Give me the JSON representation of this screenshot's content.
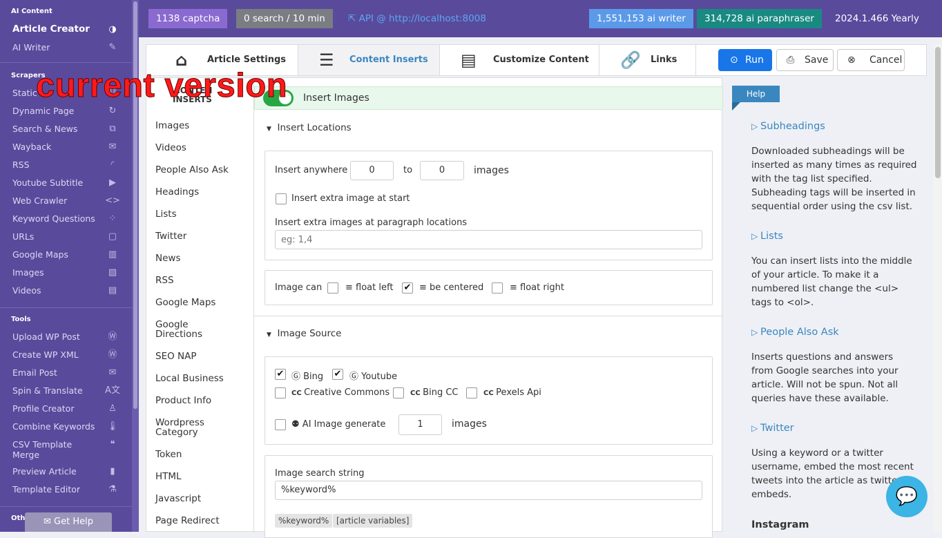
{
  "sidebar": {
    "ai_content_heading": "AI Content",
    "ai_items": [
      {
        "label": "Article Creator",
        "icon": "openai-icon"
      },
      {
        "label": "AI Writer",
        "icon": "edit-icon"
      }
    ],
    "scrapers_heading": "Scrapers",
    "scraper_items": [
      {
        "label": "Static",
        "icon": "link-icon"
      },
      {
        "label": "Dynamic Page",
        "icon": "refresh-icon"
      },
      {
        "label": "Search & News",
        "icon": "copy-icon"
      },
      {
        "label": "Wayback",
        "icon": "mail-icon"
      },
      {
        "label": "RSS",
        "icon": "rss-icon"
      },
      {
        "label": "Youtube Subtitle",
        "icon": "youtube-icon"
      },
      {
        "label": "Web Crawler",
        "icon": "code-icon"
      },
      {
        "label": "Keyword Questions",
        "icon": "grid-icon"
      },
      {
        "label": "URLs",
        "icon": "window-icon"
      },
      {
        "label": "Google Maps",
        "icon": "map-icon"
      },
      {
        "label": "Images",
        "icon": "image-icon"
      },
      {
        "label": "Videos",
        "icon": "film-icon"
      }
    ],
    "tools_heading": "Tools",
    "tool_items": [
      {
        "label": "Upload WP Post",
        "icon": "wordpress-icon"
      },
      {
        "label": "Create WP XML",
        "icon": "wordpress-icon"
      },
      {
        "label": "Email Post",
        "icon": "mail-icon"
      },
      {
        "label": "Spin & Translate",
        "icon": "translate-icon"
      },
      {
        "label": "Profile Creator",
        "icon": "user-icon"
      },
      {
        "label": "Combine Keywords",
        "icon": "thermometer-icon"
      },
      {
        "label": "CSV Template Merge",
        "icon": "quote-icon"
      },
      {
        "label": "Preview Article",
        "icon": "file-icon"
      },
      {
        "label": "Template Editor",
        "icon": "flask-icon"
      }
    ],
    "other_heading": "Othe",
    "get_help": "Get Help"
  },
  "topbar": {
    "captcha": "1138 captcha",
    "search": "0 search / 10 min",
    "api": "API @ http://localhost:8008",
    "ai_writer": "1,551,153 ai writer",
    "paraphraser": "314,728 ai paraphraser",
    "version": "2024.1.466 Yearly"
  },
  "tabs": {
    "article_settings": "Article Settings",
    "content_inserts": "Content Inserts",
    "customize_content": "Customize Content",
    "links": "Links"
  },
  "buttons": {
    "run": "Run",
    "save": "Save",
    "cancel": "Cancel"
  },
  "left_nav": {
    "heading_top": "CONTEN",
    "heading_bottom": "INSERTS",
    "items": [
      "Images",
      "Videos",
      "People Also Ask",
      "Headings",
      "Lists",
      "Twitter",
      "News",
      "RSS",
      "Google Maps",
      "Google Directions",
      "SEO NAP",
      "Local Business",
      "Product Info",
      "Wordpress Category",
      "Token",
      "HTML",
      "Javascript",
      "Page Redirect"
    ]
  },
  "insert_images": {
    "label": "Insert Images"
  },
  "insert_locations": {
    "title": "Insert Locations",
    "insert_anywhere": "Insert anywhere",
    "from_value": "0",
    "to_label": "to",
    "to_value": "0",
    "images_label": "images",
    "extra_start": "Insert extra image at start",
    "paragraph_label": "Insert extra images at paragraph locations",
    "paragraph_placeholder": "eg: 1,4",
    "image_can": "Image can",
    "float_left": "float left",
    "be_centered": "be centered",
    "float_right": "float right"
  },
  "image_source": {
    "title": "Image Source",
    "bing": "Bing",
    "youtube": "Youtube",
    "creative_commons": "Creative Commons",
    "bing_cc": "Bing CC",
    "pexels": "Pexels Api",
    "ai_generate": "AI Image generate",
    "ai_count": "1",
    "images_label": "images",
    "search_label": "Image search string",
    "search_value": "%keyword%",
    "tag1": "%keyword%",
    "tag2": "[article variables]"
  },
  "help": {
    "tab": "Help",
    "sections": [
      {
        "title": "Subheadings",
        "text": "Downloaded subheadings will be inserted as many times as required with the tag list specified. Subheading tags will be inserted in sequential order using the csv list."
      },
      {
        "title": "Lists",
        "text": "You can insert lists into the middle of your article. To make it a numbered list change the <ul> tags to <ol>."
      },
      {
        "title": "People Also Ask",
        "text": "Inserts questions and answers from Google searches into your article. Will not be spun. Not all queries have these available."
      },
      {
        "title": "Twitter",
        "text": "Using a keyword or a twitter username, embed the most recent tweets into the article as twitter embeds."
      }
    ],
    "next_title": "Instagram"
  },
  "overlay": "current version",
  "colors": {
    "sidebar": "#5a4a9c",
    "captcha": "#8a6ad0",
    "search": "#7a7d82",
    "ai_writer": "#5b9ae8",
    "paraphraser": "#198a82",
    "run": "#1976e8",
    "green_bar": "#e8f8ec",
    "link": "#3a87c0"
  }
}
